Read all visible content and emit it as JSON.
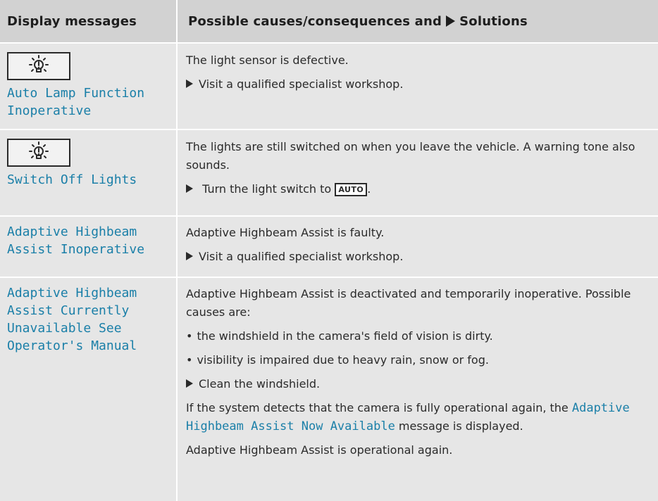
{
  "header": {
    "col1": "Display messages",
    "col2_before": "Possible causes/consequences and",
    "col2_after": "Solutions"
  },
  "rows": [
    {
      "icon": "light-bulb-warning-icon",
      "message_line1": "Auto Lamp Function",
      "message_line2": "Inoperative",
      "text1": "The light sensor is defective.",
      "step1": "Visit a qualified specialist workshop."
    },
    {
      "icon": "light-bulb-warning-icon",
      "message_line1": "Switch Off Lights",
      "text1": "The lights are still switched on when you leave the vehicle. A warning tone also sounds.",
      "step1_before": "Turn the light switch to",
      "step1_key": "AUTO",
      "step1_after": "."
    },
    {
      "message_line1": "Adaptive Highbeam",
      "message_line2": "Assist Inoperative",
      "text1": "Adaptive Highbeam Assist is faulty.",
      "step1": "Visit a qualified specialist workshop."
    },
    {
      "message_line1": "Adaptive Highbeam",
      "message_line2": "Assist Currently",
      "message_line3": "Unavailable See",
      "message_line4": "Operator's Manual",
      "text1": "Adaptive Highbeam Assist is deactivated and temporarily inoperative. Possible causes are:",
      "bullet1": "the windshield in the camera's field of vision is dirty.",
      "bullet2": "visibility is impaired due to heavy rain, snow or fog.",
      "step1": "Clean the windshield.",
      "text2_before": "If the system detects that the camera is fully operational again, the",
      "text2_msg": "Adaptive Highbeam Assist Now Available",
      "text2_after": "message is displayed.",
      "text3": "Adaptive Highbeam Assist is operational again."
    }
  ],
  "colors": {
    "header_bg": "#d2d2d2",
    "cell_bg": "#e6e6e6",
    "message_text": "#1a7fa8"
  }
}
